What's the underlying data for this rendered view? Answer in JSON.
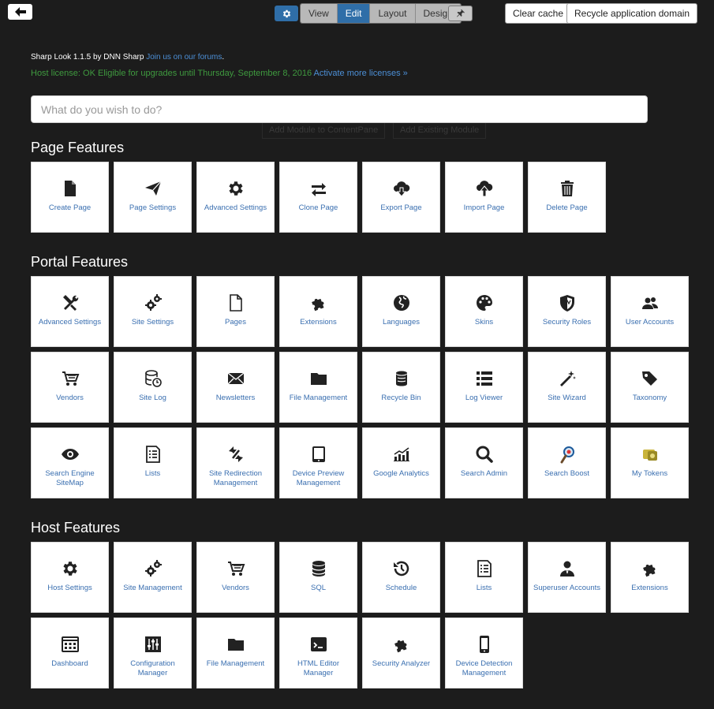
{
  "toolbar": {
    "modes": [
      "View",
      "Edit",
      "Layout",
      "Design"
    ],
    "active_mode": "Edit",
    "clear_cache": "Clear cache",
    "recycle": "Recycle application domain"
  },
  "info": {
    "product": "Sharp Look 1.1.5 by DNN Sharp",
    "forum_link": "Join us on our forums",
    "license_text": "Host license: OK Eligible for upgrades until Thursday, September 8, 2016",
    "license_link": "Activate more licenses »"
  },
  "search": {
    "placeholder": "What do you wish to do?"
  },
  "ghost_buttons": [
    "Add Module to ContentPane",
    "Add Existing Module"
  ],
  "sections": {
    "page": {
      "title": "Page Features",
      "items": [
        {
          "label": "Create Page",
          "icon": "file-icon"
        },
        {
          "label": "Page Settings",
          "icon": "paper-plane-icon"
        },
        {
          "label": "Advanced Settings",
          "icon": "gear-icon"
        },
        {
          "label": "Clone Page",
          "icon": "exchange-icon"
        },
        {
          "label": "Export Page",
          "icon": "cloud-download-icon"
        },
        {
          "label": "Import Page",
          "icon": "cloud-upload-icon"
        },
        {
          "label": "Delete Page",
          "icon": "trash-icon"
        }
      ]
    },
    "portal": {
      "title": "Portal Features",
      "items": [
        {
          "label": "Advanced Settings",
          "icon": "wrench-screwdriver-icon"
        },
        {
          "label": "Site Settings",
          "icon": "gears-icon"
        },
        {
          "label": "Pages",
          "icon": "page-outline-icon"
        },
        {
          "label": "Extensions",
          "icon": "puzzle-icon"
        },
        {
          "label": "Languages",
          "icon": "globe-icon"
        },
        {
          "label": "Skins",
          "icon": "palette-icon"
        },
        {
          "label": "Security Roles",
          "icon": "shield-icon"
        },
        {
          "label": "User Accounts",
          "icon": "users-icon"
        },
        {
          "label": "Vendors",
          "icon": "cart-icon"
        },
        {
          "label": "Site Log",
          "icon": "database-clock-icon"
        },
        {
          "label": "Newsletters",
          "icon": "envelope-icon"
        },
        {
          "label": "File Management",
          "icon": "folder-icon"
        },
        {
          "label": "Recycle Bin",
          "icon": "bin-icon"
        },
        {
          "label": "Log Viewer",
          "icon": "list-icon"
        },
        {
          "label": "Site Wizard",
          "icon": "magic-wand-icon"
        },
        {
          "label": "Taxonomy",
          "icon": "tags-icon"
        },
        {
          "label": "Search Engine SiteMap",
          "icon": "eye-icon"
        },
        {
          "label": "Lists",
          "icon": "document-list-icon"
        },
        {
          "label": "Site Redirection Management",
          "icon": "redirect-arrows-icon"
        },
        {
          "label": "Device Preview Management",
          "icon": "tablet-icon"
        },
        {
          "label": "Google Analytics",
          "icon": "bar-chart-icon"
        },
        {
          "label": "Search Admin",
          "icon": "magnifier-icon"
        },
        {
          "label": "Search Boost",
          "icon": "search-boost-icon"
        },
        {
          "label": "My Tokens",
          "icon": "tokens-icon"
        }
      ]
    },
    "host": {
      "title": "Host Features",
      "items": [
        {
          "label": "Host Settings",
          "icon": "gear-icon"
        },
        {
          "label": "Site Management",
          "icon": "gears-icon"
        },
        {
          "label": "Vendors",
          "icon": "cart-icon"
        },
        {
          "label": "SQL",
          "icon": "database-icon"
        },
        {
          "label": "Schedule",
          "icon": "history-icon"
        },
        {
          "label": "Lists",
          "icon": "document-list-icon"
        },
        {
          "label": "Superuser Accounts",
          "icon": "user-icon"
        },
        {
          "label": "Extensions",
          "icon": "puzzle-icon"
        },
        {
          "label": "Dashboard",
          "icon": "dashboard-icon"
        },
        {
          "label": "Configuration Manager",
          "icon": "sliders-icon"
        },
        {
          "label": "File Management",
          "icon": "folder-icon"
        },
        {
          "label": "HTML Editor Manager",
          "icon": "terminal-icon"
        },
        {
          "label": "Security Analyzer",
          "icon": "puzzle-icon"
        },
        {
          "label": "Device Detection Management",
          "icon": "phone-icon"
        }
      ]
    }
  },
  "colors": {
    "accent": "#2f6ea8",
    "link": "#3a6fb0",
    "license_ok": "#3f9a3f",
    "background": "#1c1c1c"
  }
}
